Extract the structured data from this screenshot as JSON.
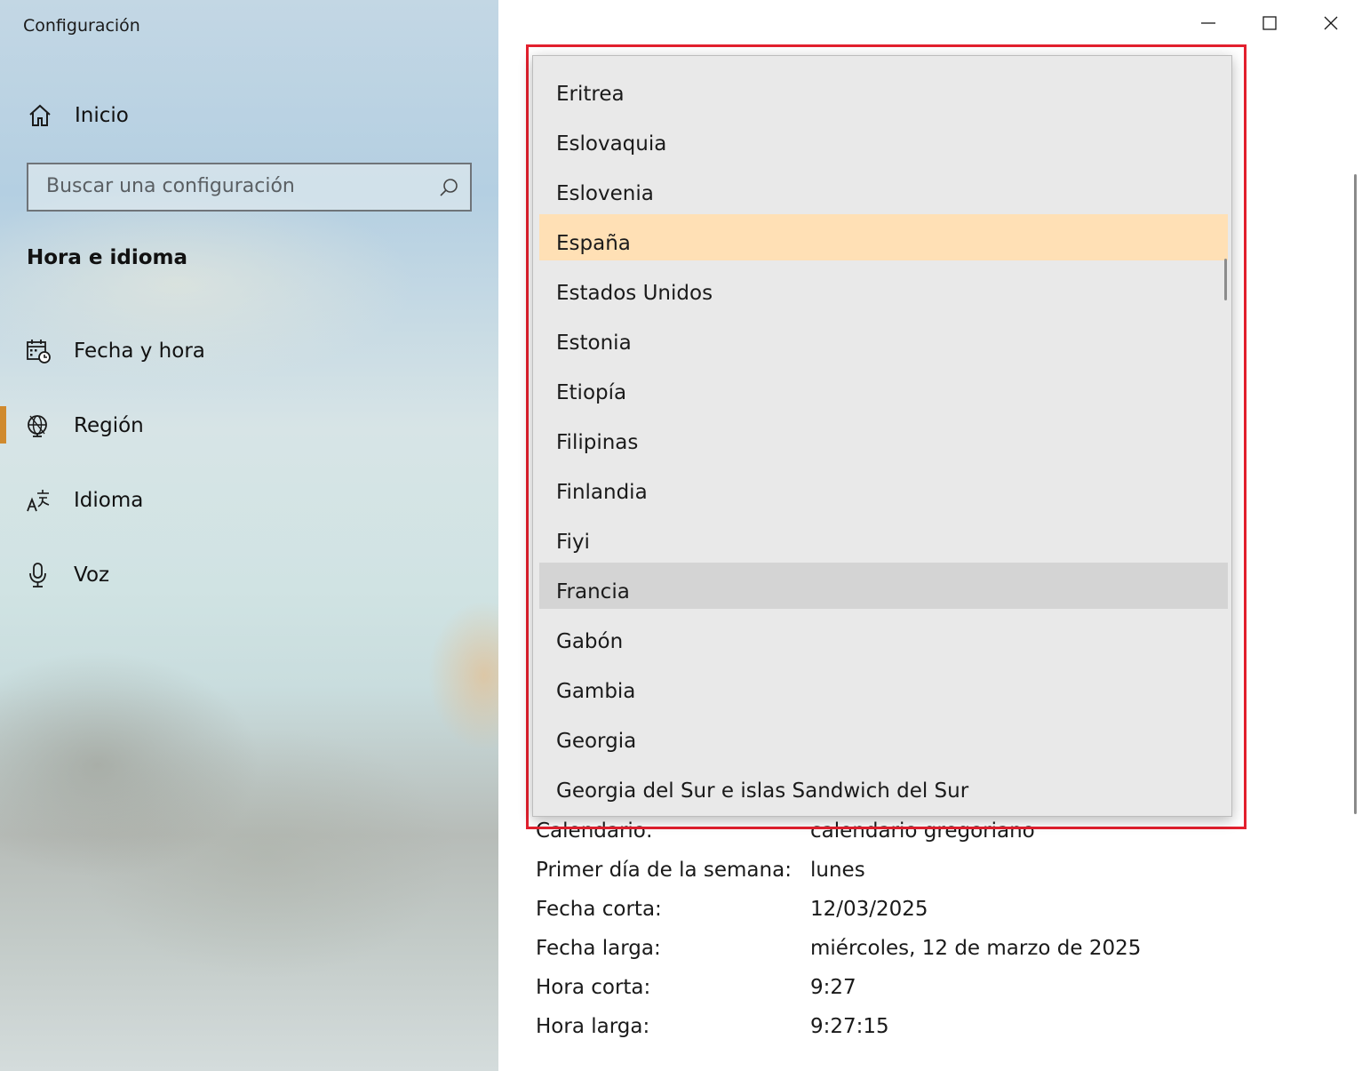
{
  "window": {
    "title": "Configuración",
    "controls": [
      "minimize",
      "maximize",
      "close"
    ]
  },
  "sidebar": {
    "home_label": "Inicio",
    "search_placeholder": "Buscar una configuración",
    "section_title": "Hora e idioma",
    "active_item": "Región",
    "accent_color": "#d08a2e",
    "items": [
      {
        "label": "Fecha y hora",
        "icon": "calendar-clock-icon"
      },
      {
        "label": "Región",
        "icon": "globe-icon"
      },
      {
        "label": "Idioma",
        "icon": "language-icon"
      },
      {
        "label": "Voz",
        "icon": "microphone-icon"
      }
    ]
  },
  "country_dropdown": {
    "selected": "España",
    "hovered": "Francia",
    "selected_color": "#ffe0b5",
    "highlight_border_color": "#e3202e",
    "items": [
      "Eritrea",
      "Eslovaquia",
      "Eslovenia",
      "España",
      "Estados Unidos",
      "Estonia",
      "Etiopía",
      "Filipinas",
      "Finlandia",
      "Fiyi",
      "Francia",
      "Gabón",
      "Gambia",
      "Georgia",
      "Georgia del Sur e islas Sandwich del Sur"
    ]
  },
  "regional_format": {
    "rows": [
      {
        "label": "Calendario:",
        "value": "calendario gregoriano"
      },
      {
        "label": "Primer día de la semana:",
        "value": "lunes"
      },
      {
        "label": "Fecha corta:",
        "value": "12/03/2025"
      },
      {
        "label": "Fecha larga:",
        "value": "miércoles, 12 de marzo de 2025"
      },
      {
        "label": "Hora corta:",
        "value": "9:27"
      },
      {
        "label": "Hora larga:",
        "value": "9:27:15"
      }
    ]
  }
}
